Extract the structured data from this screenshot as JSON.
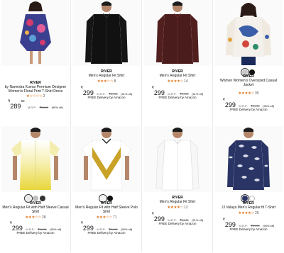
{
  "products": [
    {
      "brand": "RIVER",
      "title": "by Narendra Kumar Premium Designer Women's Floral Print T-Shirt Dress",
      "stars": "★☆☆☆☆",
      "rating_count": "2",
      "rupee": "₹",
      "price": "289",
      "price_sup": "50",
      "mrp_label": "M.R.P:",
      "mrp": "₹2,899",
      "discount": "(90% off)",
      "delivery": "",
      "swatches": [],
      "image": "floral-dress"
    },
    {
      "brand": "RIVER",
      "title": "Men's Regular Fit Shirt",
      "stars": "★★★☆☆",
      "rating_count": "8",
      "rupee": "₹",
      "price": "299",
      "price_sup": "",
      "mrp_label": "M.R.P:",
      "mrp": "₹2,199",
      "discount": "(91% off)",
      "delivery": "FREE Delivery by Amazon",
      "swatches": [],
      "image": "black-shirt"
    },
    {
      "brand": "RIVER",
      "title": "Men's Regular Fit Shirt",
      "stars": "★★★★☆",
      "rating_count": "14",
      "rupee": "₹",
      "price": "299",
      "price_sup": "",
      "mrp_label": "M.R.P:",
      "mrp": "₹2,199",
      "discount": "(91% off)",
      "delivery": "FREE Delivery by Amazon",
      "swatches": [],
      "image": "maroon-shirt"
    },
    {
      "brand": "RIVER",
      "title": "Women Women's Oversized Casual Jacket",
      "stars": "★★★★☆",
      "rating_count": "35",
      "rupee": "₹",
      "price": "299",
      "price_sup": "",
      "mrp_label": "M.R.P:",
      "mrp": "₹2,999",
      "discount": "(90% off)",
      "delivery": "FREE Delivery by Amazon",
      "swatches": [
        "#c8c8c8",
        "#111111"
      ],
      "image": "print-jacket"
    },
    {
      "brand": "RIVER",
      "title": "Men's Regular Fit with Half Sleeve Casual Shirt",
      "stars": "★★★☆☆",
      "rating_count": "28",
      "rupee": "₹",
      "price": "299",
      "price_sup": "",
      "mrp_label": "M.R.P:",
      "mrp": "₹2,999",
      "discount": "(90% off)",
      "delivery": "FREE Delivery by Amazon",
      "swatches": [
        "#e8e8e8",
        "#bfbfbf",
        "#333333"
      ],
      "image": "yellow-shirt"
    },
    {
      "brand": "RIVER",
      "title": "Men's Regular Fit with Half Sleeve Polo Shirt",
      "stars": "★★★☆☆",
      "rating_count": "71",
      "rupee": "₹",
      "price": "299",
      "price_sup": "",
      "mrp_label": "M.R.P:",
      "mrp": "₹2,999",
      "discount": "(90% off)",
      "delivery": "FREE Delivery by Amazon",
      "swatches": [
        "#f2f2f2",
        "#111111"
      ],
      "image": "yellow-polo"
    },
    {
      "brand": "RIVER",
      "title": "Men's Regular Fit Shirt",
      "stars": "★★★★☆",
      "rating_count": "12",
      "rupee": "₹",
      "price": "299",
      "price_sup": "",
      "mrp_label": "M.R.P:",
      "mrp": "₹2,199",
      "discount": "(91% off)",
      "delivery": "FREE Delivery by Amazon",
      "swatches": [],
      "image": "white-shirt"
    },
    {
      "brand": "RIVER",
      "title": "JJ Valaya Men's Regular fit T-Shirt",
      "stars": "★★★★☆",
      "rating_count": "25",
      "rupee": "₹",
      "price": "299",
      "price_sup": "",
      "mrp_label": "M.R.P:",
      "mrp": "₹2,999",
      "discount": "(90% off)",
      "delivery": "FREE Delivery by Amazon",
      "swatches": [
        "#2a3566",
        "#ffffff"
      ],
      "image": "navy-print-tee"
    }
  ]
}
